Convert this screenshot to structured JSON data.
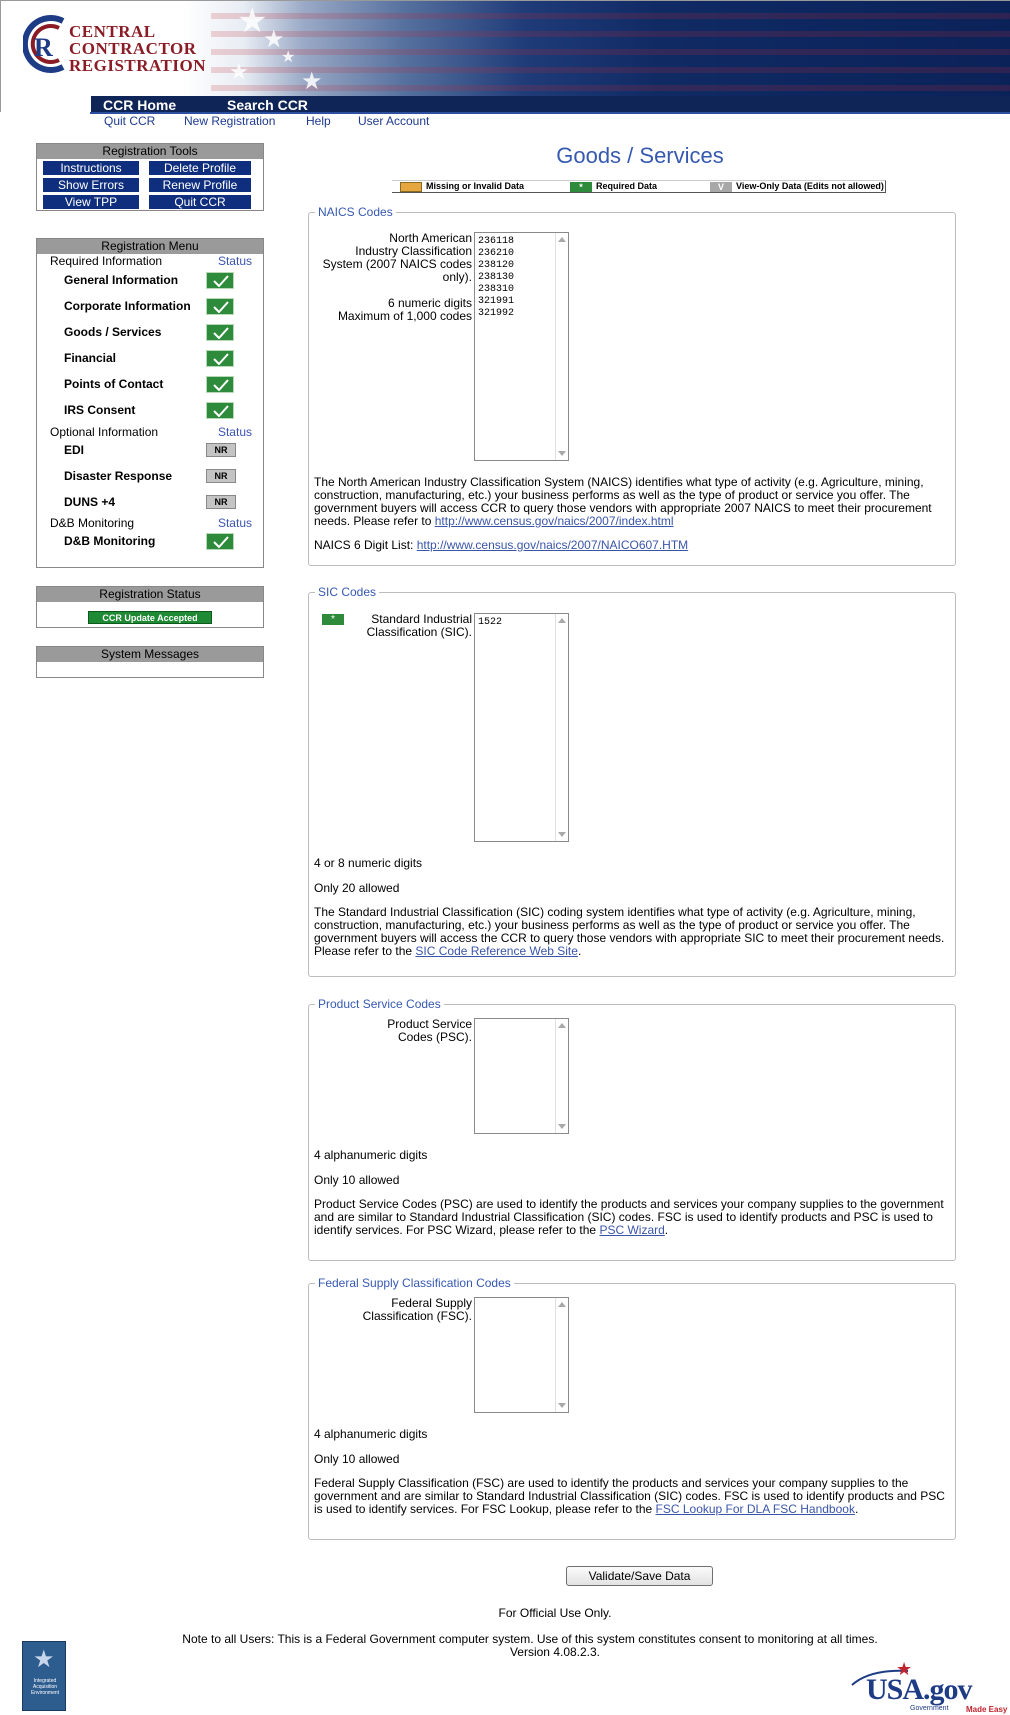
{
  "header": {
    "logo_letter": "R",
    "logo_lines": [
      "CENTRAL",
      "CONTRACTOR",
      "REGISTRATION"
    ],
    "nav_primary": [
      "CCR Home",
      "Search CCR"
    ],
    "nav_secondary": [
      "Quit CCR",
      "New Registration",
      "Help",
      "User Account"
    ]
  },
  "registration_tools": {
    "title": "Registration Tools",
    "buttons": [
      "Instructions",
      "Delete Profile",
      "Show Errors",
      "Renew Profile",
      "View TPP",
      "Quit CCR"
    ]
  },
  "registration_menu": {
    "title": "Registration Menu",
    "required_heading": "Required Information",
    "optional_heading": "Optional Information",
    "dnb_heading": "D&B Monitoring",
    "status_label": "Status",
    "required_items": [
      "General Information",
      "Corporate Information",
      "Goods / Services",
      "Financial",
      "Points of Contact",
      "IRS Consent"
    ],
    "optional_items": [
      "EDI",
      "Disaster Response",
      "DUNS +4"
    ],
    "optional_status": "NR",
    "dnb_items": [
      "D&B Monitoring"
    ]
  },
  "registration_status": {
    "title": "Registration Status",
    "value": "CCR Update Accepted"
  },
  "system_messages": {
    "title": "System Messages"
  },
  "main": {
    "title": "Goods / Services",
    "legend": {
      "missing": "Missing or Invalid Data",
      "required": "Required Data",
      "required_symbol": "*",
      "view_only_symbol": "V",
      "view_only": "View-Only Data (Edits not allowed)"
    },
    "naics": {
      "legend": "NAICS Codes",
      "label_lines": [
        "North American",
        "Industry Classification",
        "System (2007 NAICS codes",
        "only)."
      ],
      "hint_lines": [
        "6 numeric digits",
        "Maximum of 1,000 codes"
      ],
      "codes": [
        "236118",
        "236210",
        "238120",
        "238130",
        "238310",
        "321991",
        "321992"
      ],
      "description": "The North American Industry Classification System (NAICS) identifies what type of activity (e.g. Agriculture, mining, construction, manufacturing, etc.) your business performs as well as the type of product or service you offer. The government buyers will access CCR to query those vendors with appropriate 2007 NAICS to meet their procurement needs. Please refer to",
      "link": "http://www.census.gov/naics/2007/index.html",
      "list_label": "NAICS 6 Digit List:",
      "list_link": "http://www.census.gov/naics/2007/NAICO607.HTM"
    },
    "sic": {
      "legend": "SIC Codes",
      "label_lines": [
        "Standard Industrial",
        "Classification (SIC)."
      ],
      "codes": [
        "1522"
      ],
      "hint1": "4 or 8 numeric digits",
      "hint2": "Only 20 allowed",
      "description": "The Standard Industrial Classification (SIC) coding system identifies what type of activity (e.g. Agriculture, mining, construction, manufacturing, etc.) your business performs as well as the type of product or service you offer. The government buyers will access the CCR to query those vendors with appropriate SIC to meet their procurement needs. Please refer to the",
      "link": "SIC Code Reference Web Site"
    },
    "psc": {
      "legend": "Product Service Codes",
      "label_lines": [
        "Product Service",
        "Codes (PSC)."
      ],
      "hint1": "4 alphanumeric digits",
      "hint2": "Only 10 allowed",
      "description": "Product Service Codes (PSC) are used to identify the products and services your company supplies to the government and are similar to Standard Industrial Classification (SIC) codes. FSC is used to identify products and PSC is used to identify services. For PSC Wizard, please refer to the",
      "link": "PSC Wizard"
    },
    "fsc": {
      "legend": "Federal Supply Classification Codes",
      "label_lines": [
        "Federal Supply",
        "Classification (FSC)."
      ],
      "hint1": "4 alphanumeric digits",
      "hint2": "Only 10 allowed",
      "description": "Federal Supply Classification (FSC) are used to identify the products and services your company supplies to the government and are similar to Standard Industrial Classification (SIC) codes. FSC is used to identify products and PSC is used to identify services. For FSC Lookup, please refer to the",
      "link": "FSC Lookup For DLA FSC Handbook"
    },
    "save_button": "Validate/Save Data"
  },
  "footer": {
    "official": "For Official Use Only.",
    "note": "Note to all Users: This is a Federal Government computer system. Use of this system constitutes consent to monitoring at all times.",
    "version": "Version 4.08.2.3.",
    "iae_lines": [
      "Integrated",
      "Acquisition",
      "Environment"
    ],
    "usagov_text": "USA.gov",
    "usagov_tagline_1": "Government",
    "usagov_tagline_2": "Made Easy"
  },
  "colors": {
    "nav_blue": "#0f2457",
    "accent_blue": "#3659b0",
    "tool_button": "#0f2f7e",
    "status_green": "#2e8b3c",
    "logo_red": "#8a1c26",
    "legend_missing": "#e6a640"
  },
  "icons": [
    "check-icon",
    "star-icon",
    "scroll-up-icon",
    "scroll-down-icon"
  ]
}
